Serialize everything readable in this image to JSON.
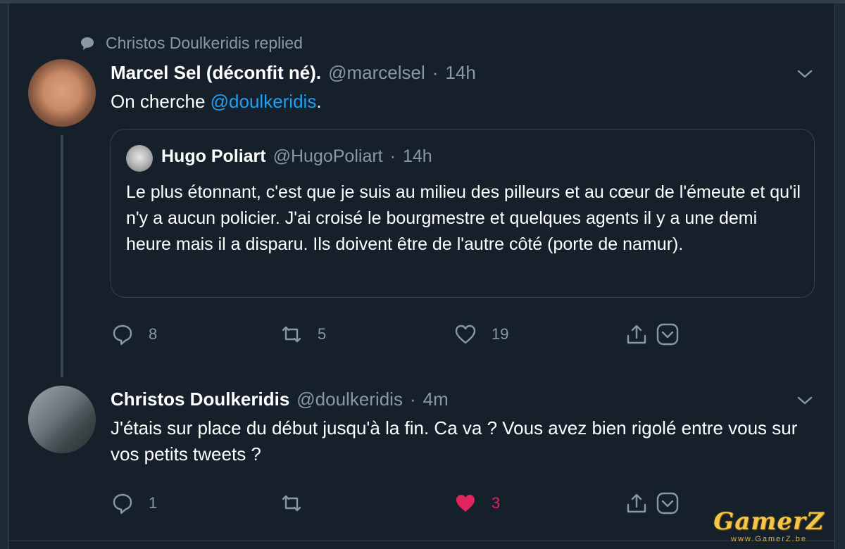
{
  "context": {
    "replied_label": "Christos Doulkeridis replied"
  },
  "tweet1": {
    "name": "Marcel Sel (déconfit né).",
    "handle": "@marcelsel",
    "separator": "·",
    "time": "14h",
    "text_before": "On cherche ",
    "mention": "@doulkeridis",
    "text_after": ".",
    "quote": {
      "name": "Hugo Poliart",
      "handle": "@HugoPoliart",
      "separator": "·",
      "time": "14h",
      "text": "Le plus étonnant, c'est que je suis au milieu des pilleurs et au cœur de l'émeute et qu'il n'y a aucun policier. J'ai croisé le bourgmestre et quelques agents il y a une demi heure mais il a disparu. Ils doivent être de l'autre côté (porte de namur)."
    },
    "actions": {
      "replies": "8",
      "retweets": "5",
      "likes": "19"
    }
  },
  "tweet2": {
    "name": "Christos Doulkeridis",
    "handle": "@doulkeridis",
    "separator": "·",
    "time": "4m",
    "text": "J'étais sur place du début jusqu'à la fin. Ca va ? Vous avez bien rigolé entre vous sur vos petits tweets ?",
    "actions": {
      "replies": "1",
      "retweets": "",
      "likes": "3",
      "liked": true
    }
  },
  "watermark": {
    "logo": "GamerZ",
    "url": "www.GamerZ.be"
  },
  "colors": {
    "background": "#15202b",
    "text_primary": "#ffffff",
    "text_secondary": "#8899a6",
    "link": "#1da1f2",
    "like_active": "#e0245e",
    "border": "#38444d"
  }
}
